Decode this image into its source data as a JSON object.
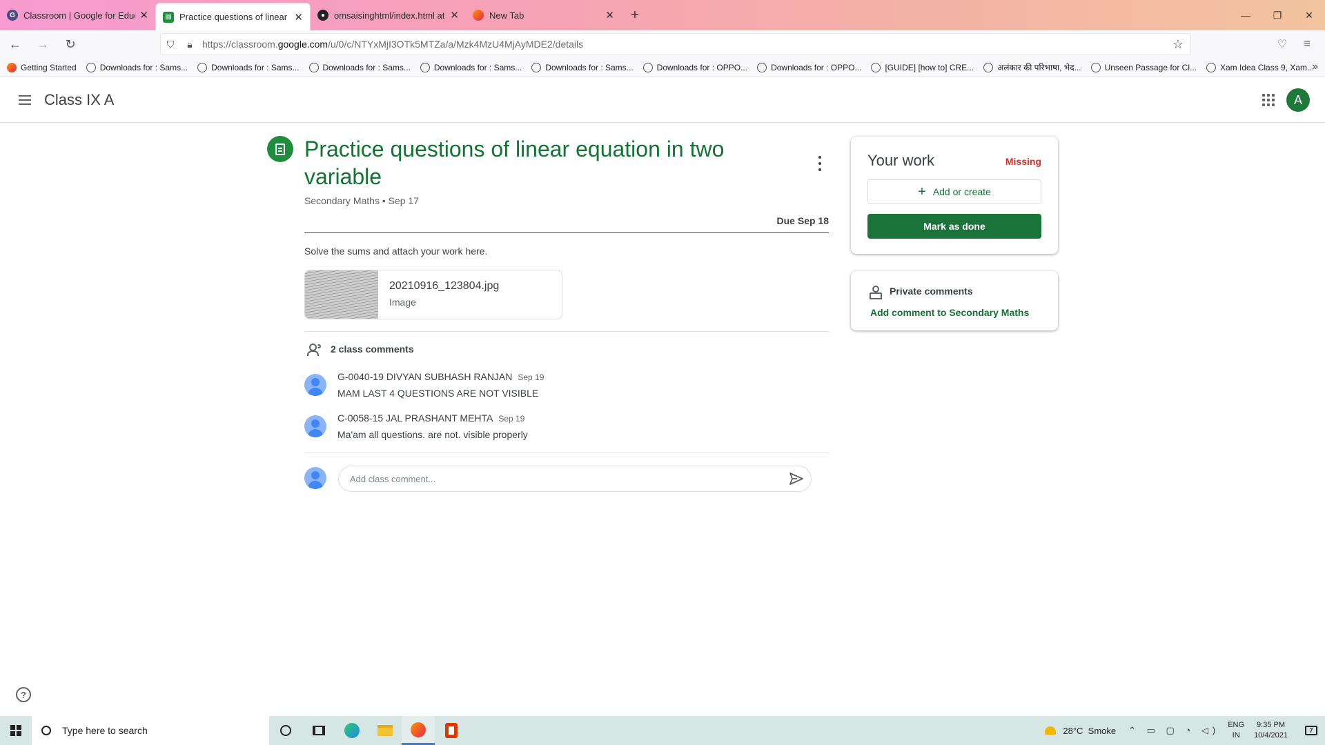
{
  "browser": {
    "tabs": [
      {
        "title": "Classroom | Google for Educati",
        "active": false,
        "icon": "google-icon"
      },
      {
        "title": "Practice questions of linear equ",
        "active": true,
        "icon": "classroom-assignment-icon"
      },
      {
        "title": "omsaisinghtml/index.html at m",
        "active": false,
        "icon": "github-icon"
      },
      {
        "title": "New Tab",
        "active": false,
        "icon": "firefox-icon"
      }
    ],
    "url_prefix": "https://classroom.",
    "url_domain": "google.com",
    "url_path": "/u/0/c/NTYxMjI3OTk5MTZa/a/Mzk4MzU4MjAyMDE2/details",
    "bookmarks": [
      "Getting Started",
      "Downloads for : Sams...",
      "Downloads for : Sams...",
      "Downloads for : Sams...",
      "Downloads for : Sams...",
      "Downloads for : Sams...",
      "Downloads for : OPPO...",
      "Downloads for : OPPO...",
      "[GUIDE] [how to] CRE...",
      "अलंकार की परिभाषा, भेद...",
      "Unseen Passage for Cl...",
      "Xam Idea Class 9, Xam..."
    ]
  },
  "header": {
    "class_name": "Class IX A",
    "avatar_letter": "A"
  },
  "assignment": {
    "title": "Practice questions of linear equation in two variable",
    "meta": "Secondary Maths • Sep 17",
    "due": "Due Sep 18",
    "instructions": "Solve the sums and attach your work here.",
    "attachment": {
      "name": "20210916_123804.jpg",
      "type": "Image"
    }
  },
  "comments": {
    "heading": "2 class comments",
    "items": [
      {
        "author": "G-0040-19 DIVYAN SUBHASH RANJAN",
        "date": "Sep 19",
        "text": "MAM LAST 4 QUESTIONS ARE NOT VISIBLE"
      },
      {
        "author": "C-0058-15 JAL PRASHANT MEHTA",
        "date": "Sep 19",
        "text": "Ma'am all questions. are not. visible properly"
      }
    ],
    "input_placeholder": "Add class comment..."
  },
  "your_work": {
    "title": "Your work",
    "status": "Missing",
    "add_label": "Add or create",
    "done_label": "Mark as done"
  },
  "private_comments": {
    "title": "Private comments",
    "link": "Add comment to Secondary Maths"
  },
  "taskbar": {
    "search_placeholder": "Type here to search",
    "weather": "28°C  Smoke",
    "lang_top": "ENG",
    "lang_bottom": "IN",
    "time": "9:35 PM",
    "date": "10/4/2021"
  },
  "colors": {
    "classroom_green": "#137333",
    "mark_done_bg": "#1a7338",
    "missing_red": "#d93025"
  }
}
